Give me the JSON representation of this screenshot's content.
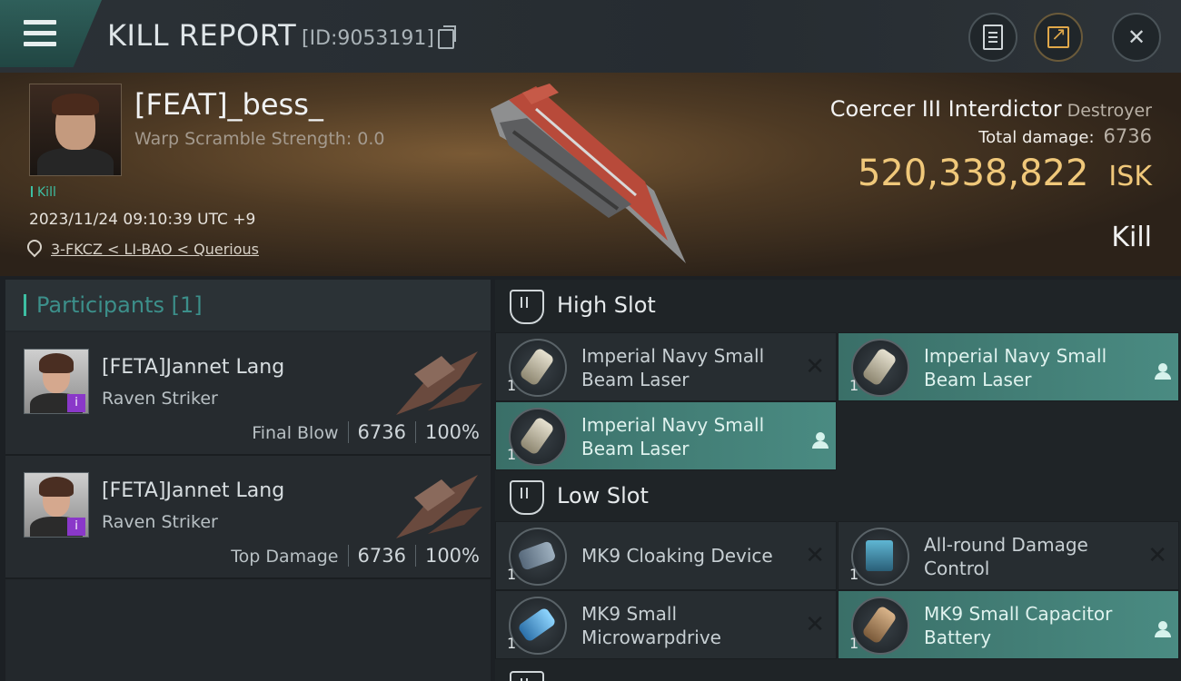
{
  "header": {
    "title": "KILL REPORT",
    "id_text": "[ID:9053191]"
  },
  "victim": {
    "name": "[FEAT]_bess_",
    "warp_scramble": "Warp Scramble Strength: 0.0",
    "tag": "Kill",
    "datetime": "2023/11/24 09:10:39 UTC +9",
    "location": "3-FKCZ < LI-BAO < Querious"
  },
  "ship": {
    "name": "Coercer III Interdictor",
    "class": "Destroyer",
    "total_damage_label": "Total damage:",
    "total_damage": "6736",
    "isk_value": "520,338,822",
    "isk_unit": "ISK",
    "result": "Kill"
  },
  "participants": {
    "title": "Participants [1]",
    "rows": [
      {
        "name": "[FETA]Jannet Lang",
        "ship": "Raven Striker",
        "label": "Final Blow",
        "damage": "6736",
        "percent": "100%",
        "badge": "i"
      },
      {
        "name": "[FETA]Jannet Lang",
        "ship": "Raven Striker",
        "label": "Top Damage",
        "damage": "6736",
        "percent": "100%",
        "badge": "i"
      }
    ]
  },
  "slots": {
    "high": {
      "title": "High Slot",
      "modules": [
        {
          "name": "Imperial Navy Small Beam Laser",
          "qty": "1",
          "state": "destroyed"
        },
        {
          "name": "Imperial Navy Small Beam Laser",
          "qty": "1",
          "state": "dropped"
        },
        {
          "name": "Imperial Navy Small Beam Laser",
          "qty": "1",
          "state": "dropped"
        }
      ]
    },
    "low": {
      "title": "Low Slot",
      "modules": [
        {
          "name": "MK9 Cloaking Device",
          "qty": "1",
          "state": "destroyed"
        },
        {
          "name": "All-round Damage Control",
          "qty": "1",
          "state": "destroyed"
        },
        {
          "name": "MK9 Small Microwarpdrive",
          "qty": "1",
          "state": "destroyed"
        },
        {
          "name": "MK9 Small Capacitor Battery",
          "qty": "1",
          "state": "dropped"
        }
      ]
    }
  },
  "icons": {
    "menu": "hamburger-icon",
    "copy": "copy-icon",
    "clipboard": "clipboard-icon",
    "share": "share-icon",
    "close": "close-icon",
    "location": "location-pin-icon",
    "slot": "shield-icon",
    "destroyed": "x-icon",
    "dropped": "person-icon"
  },
  "colors": {
    "accent_teal": "#3dbfa3",
    "isk_gold": "#f0c87a",
    "dropped_bg": "#4a8b82",
    "badge_purple": "#8a38c9"
  }
}
